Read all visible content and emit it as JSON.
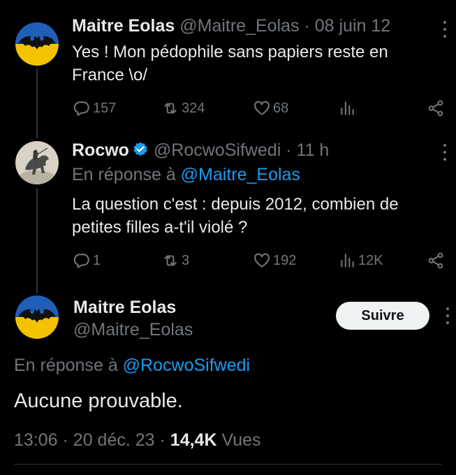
{
  "tweet1": {
    "name": "Maitre Eolas",
    "handle": "@Maitre_Eolas",
    "sep": "·",
    "time": "08 juin 12",
    "text_line1": "Yes ! Mon pédophile sans papiers reste en",
    "text_line2": "France \\o/",
    "replies": "157",
    "retweets": "324",
    "likes": "68"
  },
  "tweet2": {
    "name": "Rocwo",
    "handle": "@RocwoSifwedi",
    "sep": "·",
    "time": "11 h",
    "reply_prefix": "En réponse à",
    "reply_to": "@Maitre_Eolas",
    "text_line1": "La question c'est : depuis 2012, combien de",
    "text_line2": "petites filles a-t'il violé ?",
    "replies": "1",
    "retweets": "3",
    "likes": "192",
    "views": "12K"
  },
  "tweet3": {
    "name": "Maitre Eolas",
    "handle": "@Maitre_Eolas",
    "follow_label": "Suivre",
    "reply_prefix": "En réponse à",
    "reply_to": "@RocwoSifwedi",
    "text": "Aucune prouvable.",
    "time": "13:06",
    "sep1": "·",
    "date": "20 déc. 23",
    "sep2": "·",
    "views_count": "14,4K",
    "views_label": "Vues"
  },
  "icons": {
    "reply": "reply-icon",
    "retweet": "retweet-icon",
    "like": "heart-icon",
    "views": "views-icon",
    "share": "share-icon",
    "more": "more-icon",
    "verified": "verified-badge-icon"
  },
  "colors": {
    "background": "#000000",
    "text": "#e7e9ea",
    "muted": "#71767b",
    "link": "#1d9bf0",
    "avatar_top": "#1f5fb8",
    "avatar_bottom": "#f3c300"
  }
}
